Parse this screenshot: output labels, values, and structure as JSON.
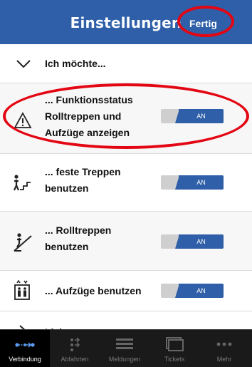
{
  "header": {
    "title": "Einstellungen",
    "done_label": "Fertig"
  },
  "section_header": {
    "label": "Ich möchte...",
    "icon": "chevron-down-icon"
  },
  "settings": [
    {
      "line1": "... Funktionsstatus",
      "line2": "Rolltreppen und",
      "line3": "Aufzüge anzeigen",
      "icon": "warning-icon",
      "toggle": "AN"
    },
    {
      "line1": "... feste Treppen",
      "line2": "benutzen",
      "icon": "stairs-icon",
      "toggle": "AN"
    },
    {
      "line1": "... Rolltreppen",
      "line2": "benutzen",
      "icon": "escalator-icon",
      "toggle": "AN"
    },
    {
      "line1": "... Aufzüge benutzen",
      "icon": "elevator-icon",
      "toggle": "AN"
    }
  ],
  "partial_row": {
    "label": "Lieb..."
  },
  "tabs": [
    {
      "label": "Verbindung",
      "icon": "connection-icon",
      "active": true
    },
    {
      "label": "Abfahrten",
      "icon": "departures-icon",
      "active": false
    },
    {
      "label": "Meldungen",
      "icon": "list-icon",
      "active": false
    },
    {
      "label": "Tickets",
      "icon": "tickets-icon",
      "active": false
    },
    {
      "label": "Mehr",
      "icon": "more-icon",
      "active": false
    }
  ],
  "colors": {
    "header": "#2e5fa8",
    "highlight": "#e30613",
    "tabbar": "#1a1a1a"
  }
}
